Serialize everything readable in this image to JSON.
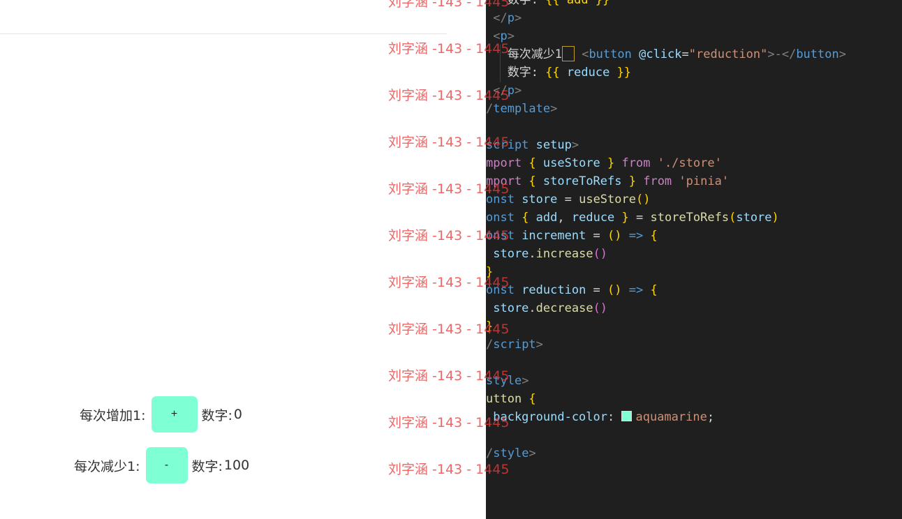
{
  "preview": {
    "row1": {
      "label": "每次增加1:",
      "button_label": "+",
      "count_label": "数字:",
      "count_value": "0"
    },
    "row2": {
      "label": "每次减少1:",
      "button_label": "-",
      "count_label": "数字:",
      "count_value": "100"
    }
  },
  "editor": {
    "lines": [
      {
        "parts": [
          {
            "t": "   数字: ",
            "c": "plain"
          },
          {
            "t": "{{ add }}",
            "c": "brace"
          }
        ]
      },
      {
        "parts": [
          {
            "t": " </",
            "c": "tag"
          },
          {
            "t": "p",
            "c": "tagname"
          },
          {
            "t": ">",
            "c": "tag"
          }
        ]
      },
      {
        "parts": [
          {
            "t": " <",
            "c": "tag"
          },
          {
            "t": "p",
            "c": "tagname"
          },
          {
            "t": ">",
            "c": "tag"
          }
        ]
      },
      {
        "parts": [
          {
            "t": "   每次减少1",
            "c": "plain"
          },
          {
            "t": "cursor",
            "c": "cursor"
          },
          {
            "t": " <",
            "c": "tag"
          },
          {
            "t": "button",
            "c": "tagname"
          },
          {
            "t": " @click",
            "c": "attr"
          },
          {
            "t": "=",
            "c": "plain"
          },
          {
            "t": "\"reduction\"",
            "c": "str"
          },
          {
            "t": ">-</",
            "c": "tag"
          },
          {
            "t": "button",
            "c": "tagname"
          },
          {
            "t": ">",
            "c": "tag"
          }
        ]
      },
      {
        "parts": [
          {
            "t": "   数字: ",
            "c": "plain"
          },
          {
            "t": "{{ ",
            "c": "brace"
          },
          {
            "t": "reduce",
            "c": "var"
          },
          {
            "t": " }}",
            "c": "brace"
          }
        ]
      },
      {
        "parts": [
          {
            "t": " </",
            "c": "tag"
          },
          {
            "t": "p",
            "c": "tagname"
          },
          {
            "t": ">",
            "c": "tag"
          }
        ]
      },
      {
        "parts": [
          {
            "t": "/",
            "c": "tag"
          },
          {
            "t": "template",
            "c": "tagname"
          },
          {
            "t": ">",
            "c": "tag"
          }
        ]
      },
      {
        "parts": []
      },
      {
        "parts": [
          {
            "t": "script",
            "c": "tagname"
          },
          {
            "t": " setup",
            "c": "attr"
          },
          {
            "t": ">",
            "c": "tag"
          }
        ]
      },
      {
        "parts": [
          {
            "t": "mport ",
            "c": "kw"
          },
          {
            "t": "{ ",
            "c": "brace"
          },
          {
            "t": "useStore",
            "c": "var"
          },
          {
            "t": " } ",
            "c": "brace"
          },
          {
            "t": "from ",
            "c": "kw"
          },
          {
            "t": "'./store'",
            "c": "str"
          }
        ]
      },
      {
        "parts": [
          {
            "t": "mport ",
            "c": "kw"
          },
          {
            "t": "{ ",
            "c": "brace"
          },
          {
            "t": "storeToRefs",
            "c": "var"
          },
          {
            "t": " } ",
            "c": "brace"
          },
          {
            "t": "from ",
            "c": "kw"
          },
          {
            "t": "'pinia'",
            "c": "str"
          }
        ]
      },
      {
        "parts": [
          {
            "t": "onst ",
            "c": "tagname"
          },
          {
            "t": "store",
            "c": "var"
          },
          {
            "t": " = ",
            "c": "op"
          },
          {
            "t": "useStore",
            "c": "fn"
          },
          {
            "t": "()",
            "c": "brace"
          }
        ]
      },
      {
        "parts": [
          {
            "t": "onst ",
            "c": "tagname"
          },
          {
            "t": "{ ",
            "c": "brace"
          },
          {
            "t": "add",
            "c": "var"
          },
          {
            "t": ", ",
            "c": "plain"
          },
          {
            "t": "reduce",
            "c": "var"
          },
          {
            "t": " } ",
            "c": "brace"
          },
          {
            "t": "= ",
            "c": "op"
          },
          {
            "t": "storeToRefs",
            "c": "fn"
          },
          {
            "t": "(",
            "c": "brace"
          },
          {
            "t": "store",
            "c": "var"
          },
          {
            "t": ")",
            "c": "brace"
          }
        ]
      },
      {
        "parts": [
          {
            "t": "onst ",
            "c": "tagname"
          },
          {
            "t": "increment",
            "c": "var"
          },
          {
            "t": " = ",
            "c": "op"
          },
          {
            "t": "()",
            "c": "brace"
          },
          {
            "t": " => ",
            "c": "tagname"
          },
          {
            "t": "{",
            "c": "brace"
          }
        ]
      },
      {
        "parts": [
          {
            "t": " store",
            "c": "var"
          },
          {
            "t": ".",
            "c": "plain"
          },
          {
            "t": "increase",
            "c": "fn"
          },
          {
            "t": "()",
            "c": "paren"
          }
        ]
      },
      {
        "parts": [
          {
            "t": "}",
            "c": "brace"
          }
        ]
      },
      {
        "parts": [
          {
            "t": "onst ",
            "c": "tagname"
          },
          {
            "t": "reduction",
            "c": "var"
          },
          {
            "t": " = ",
            "c": "op"
          },
          {
            "t": "()",
            "c": "brace"
          },
          {
            "t": " => ",
            "c": "tagname"
          },
          {
            "t": "{",
            "c": "brace"
          }
        ]
      },
      {
        "parts": [
          {
            "t": " store",
            "c": "var"
          },
          {
            "t": ".",
            "c": "plain"
          },
          {
            "t": "decrease",
            "c": "fn"
          },
          {
            "t": "()",
            "c": "paren"
          }
        ]
      },
      {
        "parts": [
          {
            "t": "}",
            "c": "brace"
          }
        ]
      },
      {
        "parts": [
          {
            "t": "/",
            "c": "tag"
          },
          {
            "t": "script",
            "c": "tagname"
          },
          {
            "t": ">",
            "c": "tag"
          }
        ]
      },
      {
        "parts": []
      },
      {
        "parts": [
          {
            "t": "style",
            "c": "tagname"
          },
          {
            "t": ">",
            "c": "tag"
          }
        ]
      },
      {
        "parts": [
          {
            "t": "utton ",
            "c": "fn"
          },
          {
            "t": "{",
            "c": "brace"
          }
        ]
      },
      {
        "parts": [
          {
            "t": " background-color",
            "c": "prop"
          },
          {
            "t": ": ",
            "c": "plain"
          },
          {
            "t": "swatch",
            "c": "swatch"
          },
          {
            "t": "aquamarine",
            "c": "str"
          },
          {
            "t": ";",
            "c": "plain"
          }
        ]
      },
      {
        "parts": []
      },
      {
        "parts": [
          {
            "t": "/",
            "c": "tag"
          },
          {
            "t": "style",
            "c": "tagname"
          },
          {
            "t": ">",
            "c": "tag"
          }
        ]
      }
    ]
  },
  "watermark": {
    "text": "刘字涵 -143 - 1445",
    "count": 11
  },
  "colors": {
    "button_bg": "#7fffd4",
    "editor_bg": "#1f1f1f",
    "watermark": "#e83c3c"
  }
}
